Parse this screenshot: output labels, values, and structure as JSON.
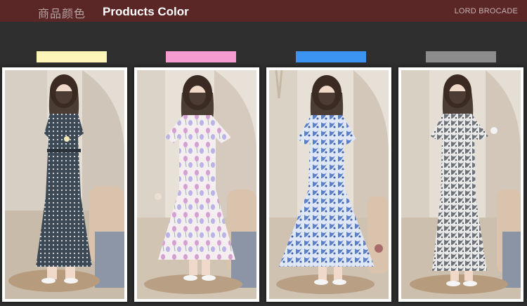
{
  "header": {
    "title_cn": "商品颜色",
    "title_en": "Products Color",
    "brand": "LORD BROCADE"
  },
  "colors": [
    {
      "swatch": "#fdf6b8",
      "dress": "navy-polka"
    },
    {
      "swatch": "#f59bd1",
      "dress": "pink-tulip"
    },
    {
      "swatch": "#3b93f2",
      "dress": "blue-floral"
    },
    {
      "swatch": "#8c8c8c",
      "dress": "grey-floral"
    }
  ]
}
